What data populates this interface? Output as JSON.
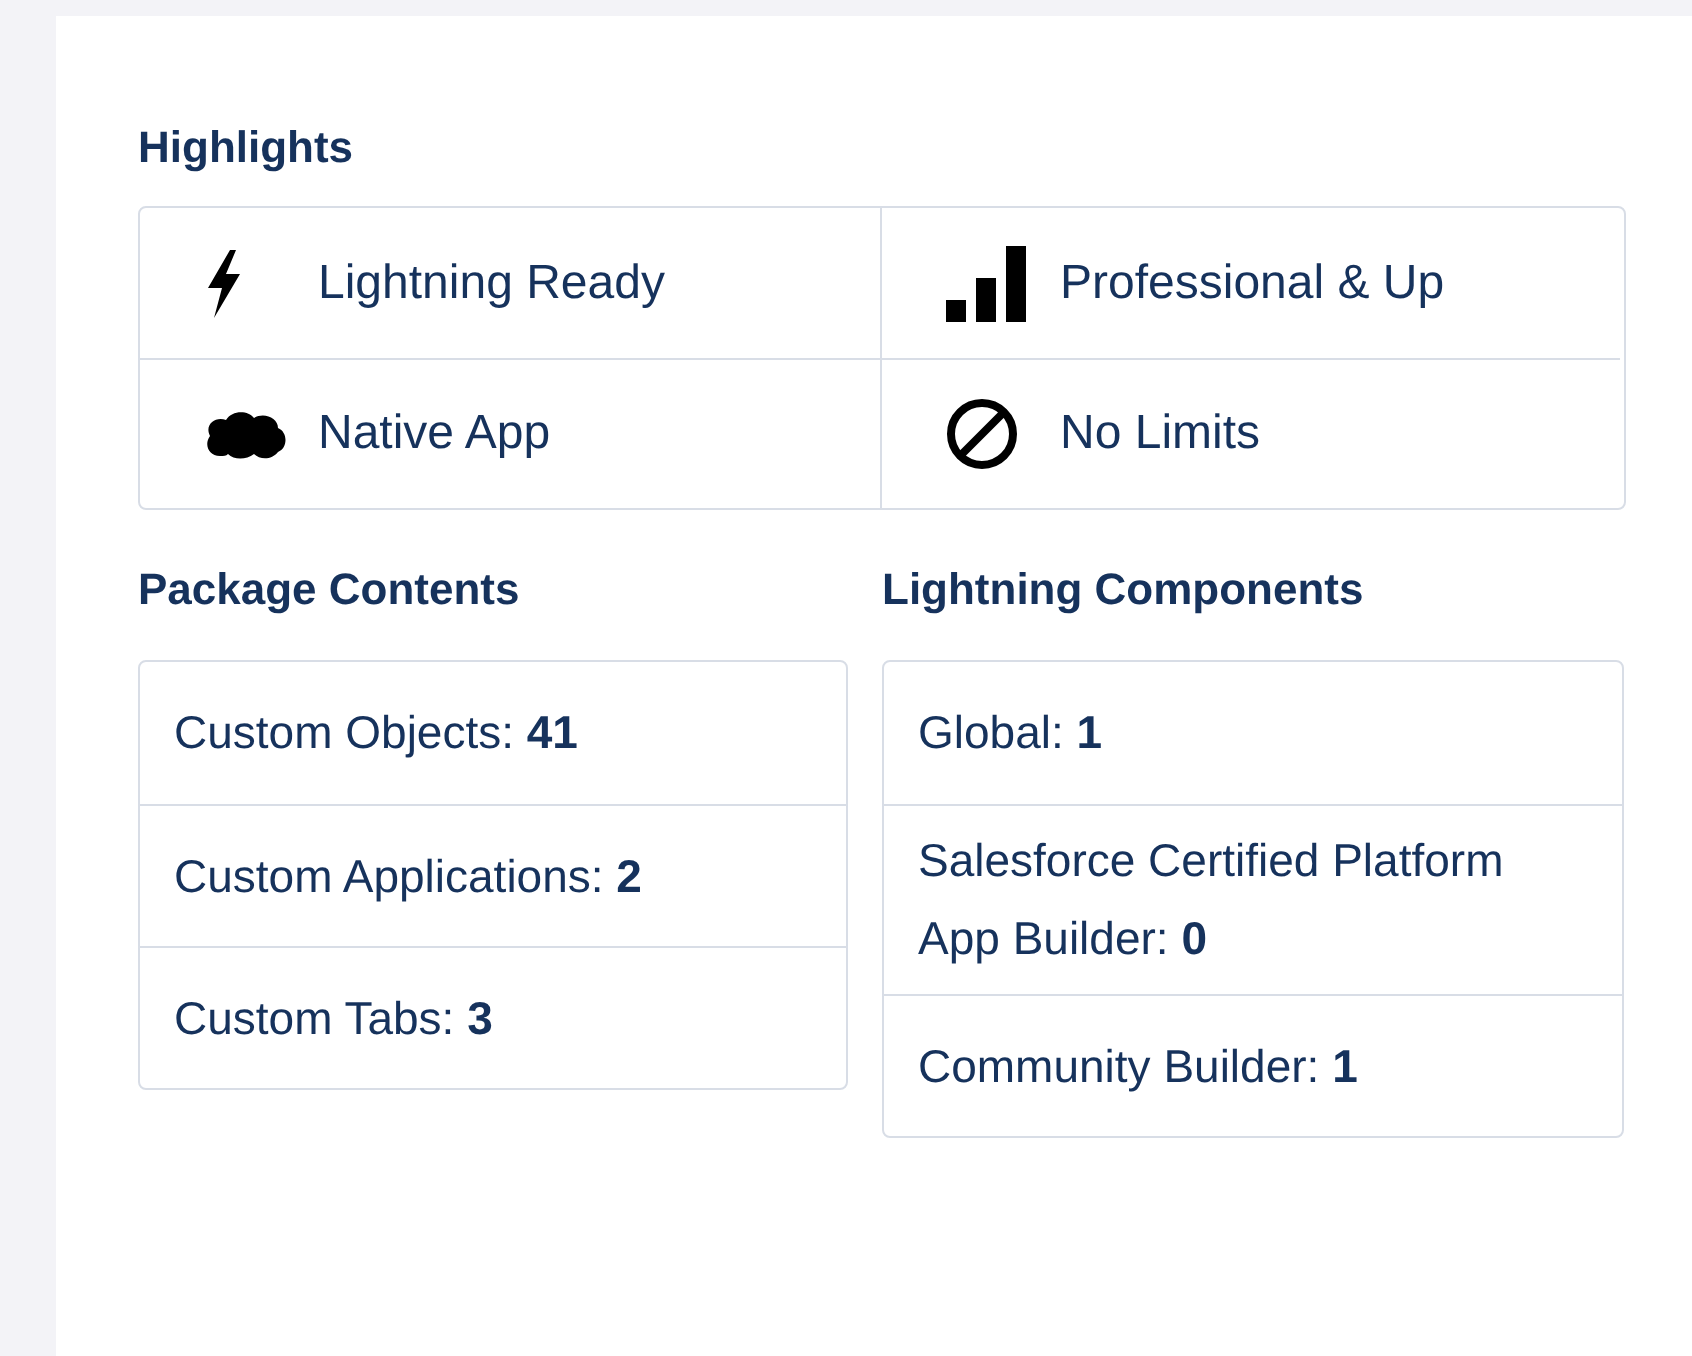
{
  "highlights": {
    "title": "Highlights",
    "items": [
      {
        "label": "Lightning Ready"
      },
      {
        "label": "Professional & Up"
      },
      {
        "label": "Native App"
      },
      {
        "label": "No Limits"
      }
    ]
  },
  "package_contents": {
    "title": "Package Contents",
    "items": [
      "Custom Objects: **41**",
      "Custom Applications: **2**",
      "Custom Tabs: **3**"
    ]
  },
  "lightning_components": {
    "title": "Lightning Components",
    "items": [
      "Global: **1**",
      "Salesforce Certified Platform App Builder: **0**",
      "Community Builder: **1**"
    ]
  }
}
